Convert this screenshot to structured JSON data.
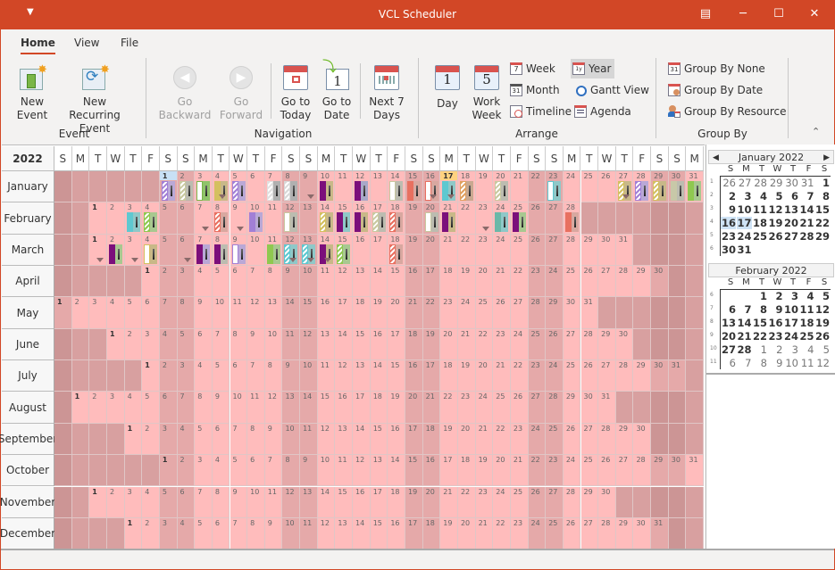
{
  "window": {
    "title": "VCL Scheduler",
    "quick_access_icon": "customize-quick-access-icon",
    "controls": [
      "restore-ribbon-icon",
      "minimize-icon",
      "maximize-icon",
      "close-icon"
    ]
  },
  "tabs": [
    {
      "label": "Home",
      "active": true
    },
    {
      "label": "View",
      "active": false
    },
    {
      "label": "File",
      "active": false
    }
  ],
  "ribbon": {
    "groups": {
      "event": "Event",
      "navigation": "Navigation",
      "arrange": "Arrange",
      "group_by": "Group By"
    },
    "new_event": {
      "line1": "New",
      "line2": "Event"
    },
    "new_recurring": {
      "line1": "New Recurring",
      "line2": "Event"
    },
    "go_backward": {
      "line1": "Go",
      "line2": "Backward"
    },
    "go_forward": {
      "line1": "Go",
      "line2": "Forward"
    },
    "go_today": {
      "line1": "Go to",
      "line2": "Today"
    },
    "go_date": {
      "line1": "Go to",
      "line2": "Date"
    },
    "next7": {
      "line1": "Next 7",
      "line2": "Days"
    },
    "day": {
      "label": "Day",
      "icon_num": "1"
    },
    "work_week": {
      "line1": "Work",
      "line2": "Week",
      "icon_num": "5"
    },
    "week": "Week",
    "month": "Month",
    "timeline": "Timeline",
    "year": "Year",
    "gantt": "Gantt View",
    "agenda": "Agenda",
    "group_none": "Group By None",
    "group_date": "Group By Date",
    "group_resource": "Group By Resource",
    "selected_view": "Year"
  },
  "scheduler": {
    "year": "2022",
    "day_headers": [
      "S",
      "M",
      "T",
      "W",
      "T",
      "F",
      "S",
      "S",
      "M",
      "T",
      "W",
      "T",
      "F",
      "S",
      "S",
      "M",
      "T",
      "W",
      "T",
      "F",
      "S",
      "S",
      "M",
      "T",
      "W",
      "T",
      "F",
      "S",
      "S",
      "M",
      "T",
      "W",
      "T",
      "F",
      "S",
      "S",
      "M"
    ],
    "months": [
      {
        "name": "January",
        "first_dow": 6,
        "days": 31
      },
      {
        "name": "February",
        "first_dow": 2,
        "days": 28
      },
      {
        "name": "March",
        "first_dow": 2,
        "days": 31
      },
      {
        "name": "April",
        "first_dow": 5,
        "days": 30
      },
      {
        "name": "May",
        "first_dow": 0,
        "days": 31
      },
      {
        "name": "June",
        "first_dow": 3,
        "days": 30
      },
      {
        "name": "July",
        "first_dow": 5,
        "days": 31
      },
      {
        "name": "August",
        "first_dow": 1,
        "days": 31
      },
      {
        "name": "September",
        "first_dow": 4,
        "days": 30
      },
      {
        "name": "October",
        "first_dow": 6,
        "days": 31
      },
      {
        "name": "November",
        "first_dow": 2,
        "days": 30
      },
      {
        "name": "December",
        "first_dow": 4,
        "days": 31
      }
    ],
    "selected_day": {
      "month": 0,
      "day": 1
    },
    "today": {
      "month": 0,
      "day": 17
    },
    "colors": {
      "today_highlight": "#ffd27f",
      "selected_highlight": "#c8e0f5"
    },
    "events": [
      {
        "m": 0,
        "d": 1,
        "a": "#a27fd6",
        "b": "#b9a8d6",
        "striped": true
      },
      {
        "m": 0,
        "d": 2,
        "a": "#c9c9a0",
        "b": "#bcbcb0",
        "striped": true
      },
      {
        "m": 0,
        "d": 3,
        "a": "#ffffff",
        "b": "#8fc36a",
        "border": "#7ab648"
      },
      {
        "m": 0,
        "d": 4,
        "a": "#d4c060",
        "b": "#c8b888",
        "more": true
      },
      {
        "m": 0,
        "d": 5,
        "a": "#a27fd6",
        "b": "#b9a8d6",
        "striped": true
      },
      {
        "m": 0,
        "d": 7,
        "a": "#e0e0e0",
        "b": "#b0b0b0",
        "striped": true
      },
      {
        "m": 0,
        "d": 8,
        "a": "#d8d8d8",
        "b": "#b0b0b0",
        "striped": true
      },
      {
        "m": 0,
        "d": 9,
        "more_only": true
      },
      {
        "m": 0,
        "d": 10,
        "a": "#7b0f7b",
        "b": "#c8b888"
      },
      {
        "m": 0,
        "d": 12,
        "a": "#7b0f7b",
        "b": "#a8a8c8"
      },
      {
        "m": 0,
        "d": 14,
        "a": "#ffffff",
        "b": "#bcbcb0",
        "border": "#c8c8a0"
      },
      {
        "m": 0,
        "d": 15,
        "a": "#e87060",
        "b": "#d8a8a0"
      },
      {
        "m": 0,
        "d": 16,
        "a": "#ffffff",
        "b": "#d8a8a0",
        "border": "#e87060",
        "more": true
      },
      {
        "m": 0,
        "d": 17,
        "a": "#5ec8d0",
        "b": "#8fc8c8",
        "more": true
      },
      {
        "m": 0,
        "d": 18,
        "a": "#e0a060",
        "b": "#c8a890",
        "striped": true
      },
      {
        "m": 0,
        "d": 20,
        "a": "#c9c9a0",
        "b": "#bcbcb0",
        "striped": true
      },
      {
        "m": 0,
        "d": 23,
        "a": "#ffffff",
        "b": "#8fc8c8",
        "border": "#5ec8d0"
      },
      {
        "m": 0,
        "d": 27,
        "a": "#d4c060",
        "b": "#c8b888",
        "striped": true,
        "more": true
      },
      {
        "m": 0,
        "d": 28,
        "a": "#a27fd6",
        "b": "#b9a8d6",
        "striped": true
      },
      {
        "m": 0,
        "d": 29,
        "a": "#d4c060",
        "b": "#c8b888",
        "striped": true
      },
      {
        "m": 0,
        "d": 30,
        "a": "#c8c8a8",
        "b": "#bcbcb0"
      },
      {
        "m": 0,
        "d": 31,
        "a": "#8fc850",
        "b": "#a8c890"
      },
      {
        "m": 1,
        "d": 3,
        "a": "#5ec8d0",
        "b": "#8fc8c8"
      },
      {
        "m": 1,
        "d": 4,
        "a": "#8fc850",
        "b": "#a8c890",
        "striped": true
      },
      {
        "m": 1,
        "d": 7,
        "more_only": true
      },
      {
        "m": 1,
        "d": 8,
        "a": "#e87060",
        "b": "#d8a8a0",
        "striped": true
      },
      {
        "m": 1,
        "d": 9,
        "more_only": true
      },
      {
        "m": 1,
        "d": 10,
        "a": "#a27fd6",
        "b": "#b9a8d6"
      },
      {
        "m": 1,
        "d": 12,
        "a": "#ffffff",
        "b": "#bcbcb0",
        "border": "#c8c8a0"
      },
      {
        "m": 1,
        "d": 14,
        "a": "#d4c060",
        "b": "#c8b888",
        "striped": true
      },
      {
        "m": 1,
        "d": 15,
        "a": "#7b0f7b",
        "b": "#8fc8c8"
      },
      {
        "m": 1,
        "d": 16,
        "a": "#7b0f7b",
        "b": "#c8b888"
      },
      {
        "m": 1,
        "d": 17,
        "a": "#c9c9a0",
        "b": "#bcbcb0",
        "striped": true
      },
      {
        "m": 1,
        "d": 18,
        "a": "#e87060",
        "b": "#d8a8a0",
        "striped": true
      },
      {
        "m": 1,
        "d": 20,
        "a": "#ffffff",
        "b": "#bcbcb0",
        "border": "#c8c8a0"
      },
      {
        "m": 1,
        "d": 21,
        "a": "#7b0f7b",
        "b": "#c8b888"
      },
      {
        "m": 1,
        "d": 23,
        "more_only": true
      },
      {
        "m": 1,
        "d": 24,
        "a": "#6ab8a8",
        "b": "#8fc8c8"
      },
      {
        "m": 1,
        "d": 25,
        "a": "#7b0f7b",
        "b": "#a8c890"
      },
      {
        "m": 1,
        "d": 28,
        "a": "#e87060",
        "b": "#d8a8a0"
      },
      {
        "m": 2,
        "d": 1,
        "more_only": true
      },
      {
        "m": 2,
        "d": 2,
        "a": "#7b0f7b",
        "b": "#a8c890"
      },
      {
        "m": 2,
        "d": 3,
        "more_only": true
      },
      {
        "m": 2,
        "d": 4,
        "a": "#ffffff",
        "b": "#c8b888",
        "border": "#d4c060"
      },
      {
        "m": 2,
        "d": 6,
        "more_only": true
      },
      {
        "m": 2,
        "d": 7,
        "a": "#7b0f7b",
        "b": "#b9a8d6"
      },
      {
        "m": 2,
        "d": 8,
        "a": "#7b0f7b",
        "b": "#bcbcb0"
      },
      {
        "m": 2,
        "d": 9,
        "a": "#ffffff",
        "b": "#b9a8d6",
        "border": "#a27fd6"
      },
      {
        "m": 2,
        "d": 11,
        "a": "#8fc850",
        "b": "#a8c890"
      },
      {
        "m": 2,
        "d": 12,
        "a": "#5ec8d0",
        "b": "#8fc8c8",
        "striped": true,
        "more": true
      },
      {
        "m": 2,
        "d": 13,
        "a": "#5ec8d0",
        "b": "#8fc8c8",
        "striped": true,
        "more": true
      },
      {
        "m": 2,
        "d": 14,
        "a": "#7b0f7b",
        "b": "#c8b888",
        "more": true
      },
      {
        "m": 2,
        "d": 15,
        "a": "#8fc850",
        "b": "#a8c890",
        "striped": true
      },
      {
        "m": 2,
        "d": 18,
        "a": "#e87060",
        "b": "#d8a8a0",
        "striped": true
      }
    ]
  },
  "mini_calendars": [
    {
      "title": "January 2022",
      "dows": [
        "S",
        "M",
        "T",
        "W",
        "T",
        "F",
        "S"
      ],
      "weeks": [
        {
          "num": "1",
          "days": [
            [
              "26",
              true
            ],
            [
              "27",
              true
            ],
            [
              "28",
              true
            ],
            [
              "29",
              true
            ],
            [
              "30",
              true
            ],
            [
              "31",
              true
            ],
            [
              "1",
              false
            ]
          ]
        },
        {
          "num": "2",
          "days": [
            [
              "2",
              false
            ],
            [
              "3",
              false
            ],
            [
              "4",
              false
            ],
            [
              "5",
              false
            ],
            [
              "6",
              false
            ],
            [
              "7",
              false
            ],
            [
              "8",
              false
            ]
          ]
        },
        {
          "num": "3",
          "days": [
            [
              "9",
              false
            ],
            [
              "10",
              false
            ],
            [
              "11",
              false
            ],
            [
              "12",
              false
            ],
            [
              "13",
              false
            ],
            [
              "14",
              false
            ],
            [
              "15",
              false
            ]
          ]
        },
        {
          "num": "4",
          "days": [
            [
              "16",
              false
            ],
            [
              "17",
              false
            ],
            [
              "18",
              false
            ],
            [
              "19",
              false
            ],
            [
              "20",
              false
            ],
            [
              "21",
              false
            ],
            [
              "22",
              false
            ]
          ]
        },
        {
          "num": "5",
          "days": [
            [
              "23",
              false
            ],
            [
              "24",
              false
            ],
            [
              "25",
              false
            ],
            [
              "26",
              false
            ],
            [
              "27",
              false
            ],
            [
              "28",
              false
            ],
            [
              "29",
              false
            ]
          ]
        },
        {
          "num": "6",
          "days": [
            [
              "30",
              false
            ],
            [
              "31",
              false
            ]
          ]
        }
      ],
      "highlighted": [
        "16",
        "17"
      ]
    },
    {
      "title": "February 2022",
      "dows": [
        "S",
        "M",
        "T",
        "W",
        "T",
        "F",
        "S"
      ],
      "weeks": [
        {
          "num": "6",
          "days": [
            [
              "",
              false
            ],
            [
              "",
              false
            ],
            [
              "1",
              false
            ],
            [
              "2",
              false
            ],
            [
              "3",
              false
            ],
            [
              "4",
              false
            ],
            [
              "5",
              false
            ]
          ]
        },
        {
          "num": "7",
          "days": [
            [
              "6",
              false
            ],
            [
              "7",
              false
            ],
            [
              "8",
              false
            ],
            [
              "9",
              false
            ],
            [
              "10",
              false
            ],
            [
              "11",
              false
            ],
            [
              "12",
              false
            ]
          ]
        },
        {
          "num": "8",
          "days": [
            [
              "13",
              false
            ],
            [
              "14",
              false
            ],
            [
              "15",
              false
            ],
            [
              "16",
              false
            ],
            [
              "17",
              false
            ],
            [
              "18",
              false
            ],
            [
              "19",
              false
            ]
          ]
        },
        {
          "num": "9",
          "days": [
            [
              "20",
              false
            ],
            [
              "21",
              false
            ],
            [
              "22",
              false
            ],
            [
              "23",
              false
            ],
            [
              "24",
              false
            ],
            [
              "25",
              false
            ],
            [
              "26",
              false
            ]
          ]
        },
        {
          "num": "10",
          "days": [
            [
              "27",
              false
            ],
            [
              "28",
              false
            ],
            [
              "1",
              true
            ],
            [
              "2",
              true
            ],
            [
              "3",
              true
            ],
            [
              "4",
              true
            ],
            [
              "5",
              true
            ]
          ]
        },
        {
          "num": "11",
          "days": [
            [
              "6",
              true
            ],
            [
              "7",
              true
            ],
            [
              "8",
              true
            ],
            [
              "9",
              true
            ],
            [
              "10",
              true
            ],
            [
              "11",
              true
            ],
            [
              "12",
              true
            ]
          ]
        }
      ],
      "highlighted": []
    }
  ]
}
